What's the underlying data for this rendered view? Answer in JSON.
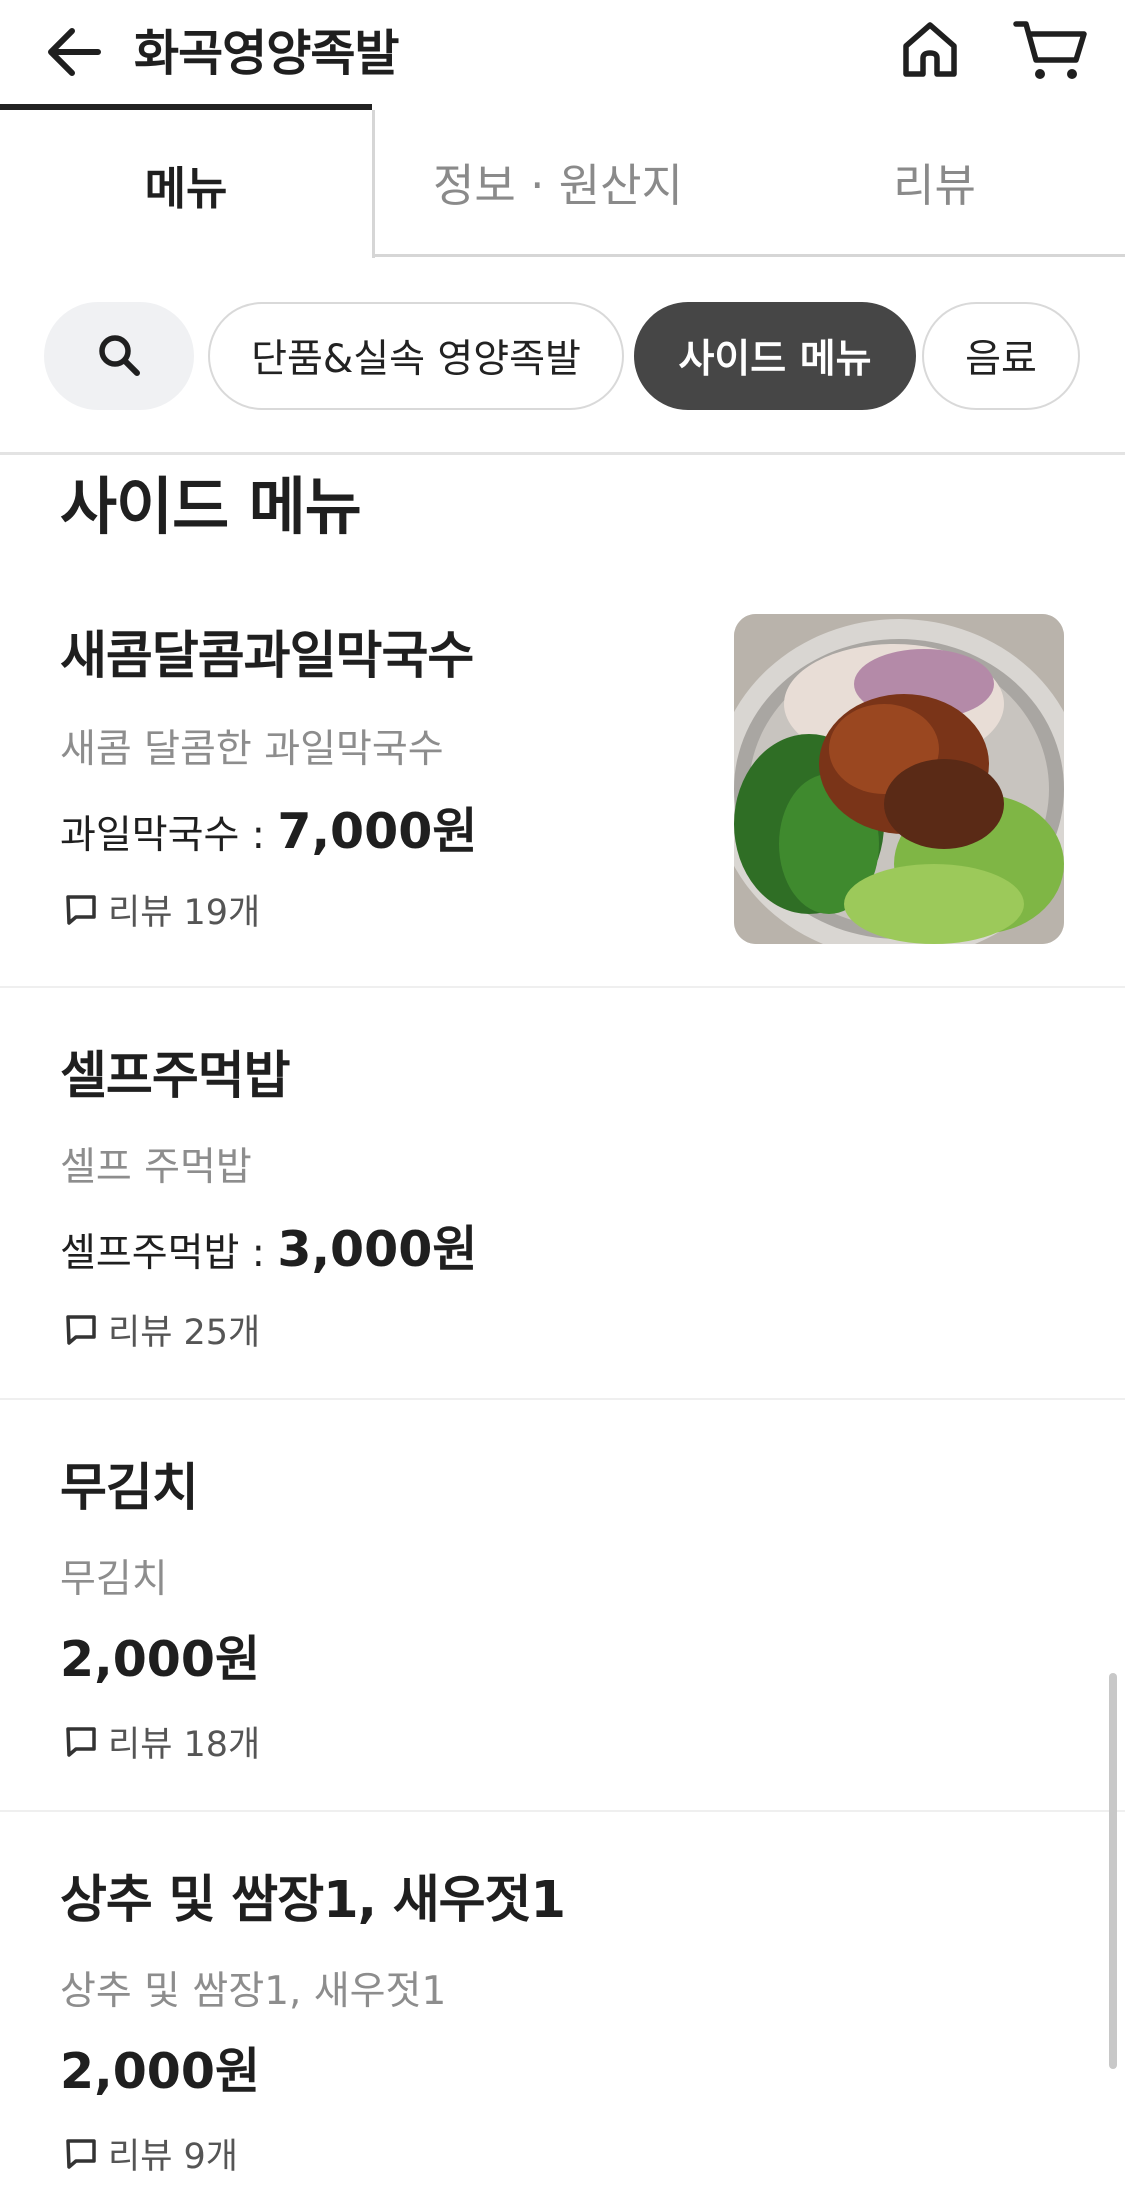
{
  "header": {
    "title": "화곡영양족발"
  },
  "tabs": [
    {
      "label": "메뉴"
    },
    {
      "label": "정보 · 원산지"
    },
    {
      "label": "리뷰"
    }
  ],
  "chips": [
    {
      "label": "단품&실속 영양족발"
    },
    {
      "label": "사이드 메뉴"
    },
    {
      "label": "음료"
    }
  ],
  "section": {
    "title": "사이드 메뉴"
  },
  "items": [
    {
      "name": "새콤달콤과일막국수",
      "description": "새콤 달콤한 과일막국수",
      "price_label": "과일막국수 : ",
      "price": "7,000원",
      "reviews": "리뷰 19개"
    },
    {
      "name": "셀프주먹밥",
      "description": "셀프 주먹밥",
      "price_label": "셀프주먹밥 : ",
      "price": "3,000원",
      "reviews": "리뷰 25개"
    },
    {
      "name": "무김치",
      "description": "무김치",
      "price_label": "",
      "price": "2,000원",
      "reviews": "리뷰 18개"
    },
    {
      "name": "상추 및 쌈장1, 새우젓1",
      "description": "상추 및 쌈장1, 새우젓1",
      "price_label": "",
      "price": "2,000원",
      "reviews": "리뷰 9개"
    }
  ],
  "icons": {
    "back": "arrow-left-icon",
    "home": "home-icon",
    "cart": "cart-icon",
    "search": "search-icon",
    "review": "speech-bubble-icon"
  },
  "colors": {
    "selected_chip": "#464646",
    "inactive_tab_text": "#8a8a8a",
    "description_text": "#8d8d8d"
  }
}
